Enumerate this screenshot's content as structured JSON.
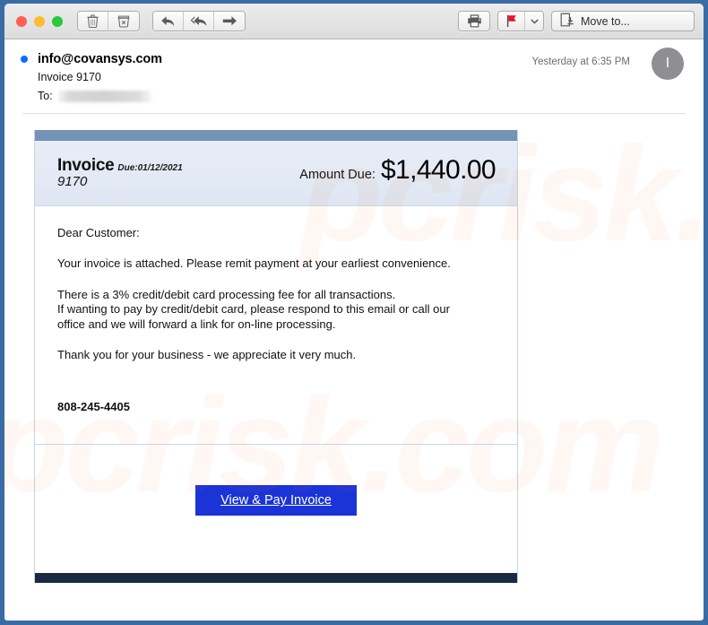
{
  "window": {
    "traffic_lights": [
      "close",
      "minimize",
      "maximize"
    ],
    "frame_color": "#3b6ba5"
  },
  "toolbar": {
    "delete_label": "Delete",
    "junk_label": "Junk",
    "reply_label": "Reply",
    "reply_all_label": "Reply All",
    "forward_label": "Forward",
    "print_label": "Print",
    "flag_label": "Flag",
    "flag_color": "#e8112d",
    "flag_menu_label": "Flag options",
    "move_to_label": "Move to..."
  },
  "message": {
    "unread": true,
    "sender": "info@covansys.com",
    "subject": "Invoice 9170",
    "to_label": "To:",
    "recipient_redacted": true,
    "timestamp": "Yesterday at 6:35 PM",
    "avatar_initial": "I"
  },
  "invoice": {
    "top_bar_color": "#7593b8",
    "footer_bar_color": "#1b2a44",
    "header": {
      "title": "Invoice",
      "due_label": "Due:01/12/2021",
      "number": "9170",
      "amount_label": "Amount Due:",
      "amount_value": "$1,440.00"
    },
    "body": {
      "greeting": "Dear Customer:",
      "paragraph_1": "Your invoice is attached. Please remit payment at your earliest convenience.",
      "paragraph_2_line_1": "There is a 3% credit/debit card processing fee for all transactions.",
      "paragraph_2_line_2": "If wanting to pay by credit/debit card, please respond to this email or call our",
      "paragraph_2_line_3": "office and we will forward a link for on-line processing.",
      "paragraph_3": "Thank you for your business - we appreciate it very much.",
      "phone": "808-245-4405"
    },
    "cta": {
      "button_label": "View & Pay Invoice",
      "button_color": "#1a34d8",
      "button_text_color": "#ffffff"
    }
  },
  "watermark": {
    "text_top": "pcrisk.com",
    "text_bottom": "pcrisk.com",
    "color": "#eb7034"
  }
}
